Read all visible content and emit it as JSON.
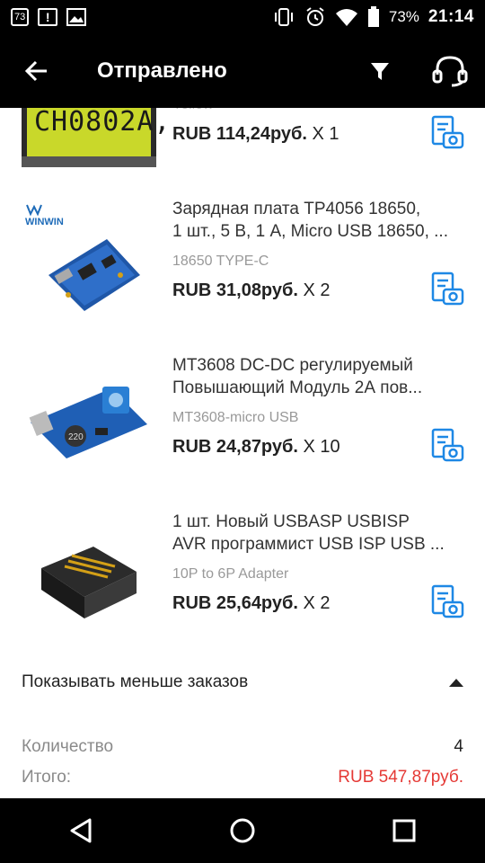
{
  "status_bar": {
    "notif_badge": "73",
    "battery": "73%",
    "time": "21:14"
  },
  "toolbar": {
    "title": "Отправлено",
    "back_icon": "arrow-left-icon",
    "filter_icon": "filter-icon",
    "support_icon": "headset-icon"
  },
  "items": [
    {
      "title_lines": [
        "",
        ""
      ],
      "variant": "Yellow",
      "price": "RUB 114,24руб.",
      "qty": " X 1",
      "thumb_text": "CH0802A,"
    },
    {
      "title_lines": [
        "Зарядная плата TP4056 18650,",
        "1 шт., 5 В, 1 А, Micro USB 18650, ..."
      ],
      "variant": "18650 TYPE-C",
      "price": "RUB 31,08руб.",
      "qty": " X 2",
      "thumb_text": "WINWIN"
    },
    {
      "title_lines": [
        "MT3608 DC-DC регулируемый",
        "Повышающий Модуль 2А пов..."
      ],
      "variant": "MT3608-micro USB",
      "price": "RUB 24,87руб.",
      "qty": " X 10",
      "thumb_text": "220"
    },
    {
      "title_lines": [
        "1 шт. Новый USBASP USBISP",
        "AVR программист USB ISP USB ..."
      ],
      "variant": "10P to 6P Adapter",
      "price": "RUB 25,64руб.",
      "qty": " X 2",
      "thumb_text": ""
    }
  ],
  "show_less_label": "Показывать меньше заказов",
  "summary": {
    "quantity_label": "Количество",
    "quantity_value": "4",
    "total_label": "Итого:",
    "total_value": "RUB 547,87руб."
  },
  "colors": {
    "accent": "#1e88e5",
    "total": "#e53935"
  }
}
